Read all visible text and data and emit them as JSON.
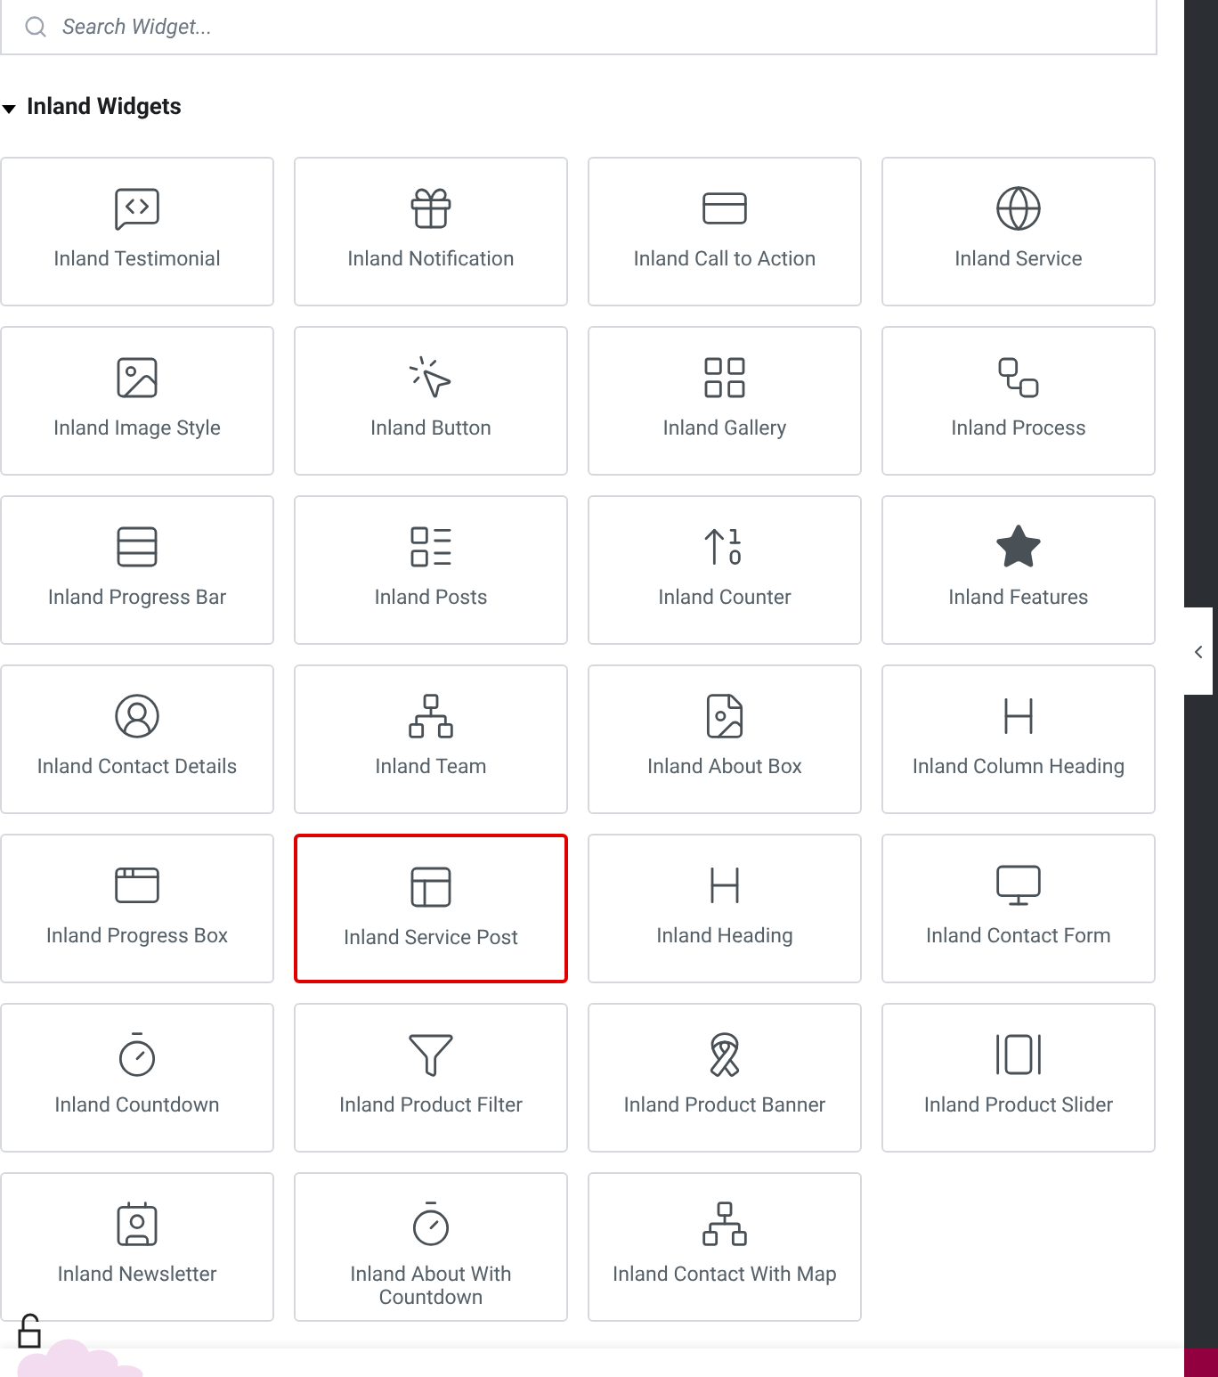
{
  "search": {
    "placeholder": "Search Widget..."
  },
  "section": {
    "title": "Inland Widgets",
    "expanded": true,
    "widgets": [
      {
        "label": "Inland Testimonial",
        "selected": false
      },
      {
        "label": "Inland Notification",
        "selected": false
      },
      {
        "label": "Inland Call to Action",
        "selected": false
      },
      {
        "label": "Inland Service",
        "selected": false
      },
      {
        "label": "Inland Image Style",
        "selected": false
      },
      {
        "label": "Inland Button",
        "selected": false
      },
      {
        "label": "Inland Gallery",
        "selected": false
      },
      {
        "label": "Inland Process",
        "selected": false
      },
      {
        "label": "Inland Progress Bar",
        "selected": false
      },
      {
        "label": "Inland Posts",
        "selected": false
      },
      {
        "label": "Inland Counter",
        "selected": false
      },
      {
        "label": "Inland Features",
        "selected": false
      },
      {
        "label": "Inland Contact Details",
        "selected": false
      },
      {
        "label": "Inland Team",
        "selected": false
      },
      {
        "label": "Inland About Box",
        "selected": false
      },
      {
        "label": "Inland Column Heading",
        "selected": false
      },
      {
        "label": "Inland Progress Box",
        "selected": false
      },
      {
        "label": "Inland Service Post",
        "selected": true
      },
      {
        "label": "Inland Heading",
        "selected": false
      },
      {
        "label": "Inland Contact Form",
        "selected": false
      },
      {
        "label": "Inland Countdown",
        "selected": false
      },
      {
        "label": "Inland Product Filter",
        "selected": false
      },
      {
        "label": "Inland Product Banner",
        "selected": false
      },
      {
        "label": "Inland Product Slider",
        "selected": false
      },
      {
        "label": "Inland Newsletter",
        "selected": false
      },
      {
        "label": "Inland About With Countdown",
        "selected": false
      },
      {
        "label": "Inland Contact With Map",
        "selected": false
      }
    ]
  }
}
